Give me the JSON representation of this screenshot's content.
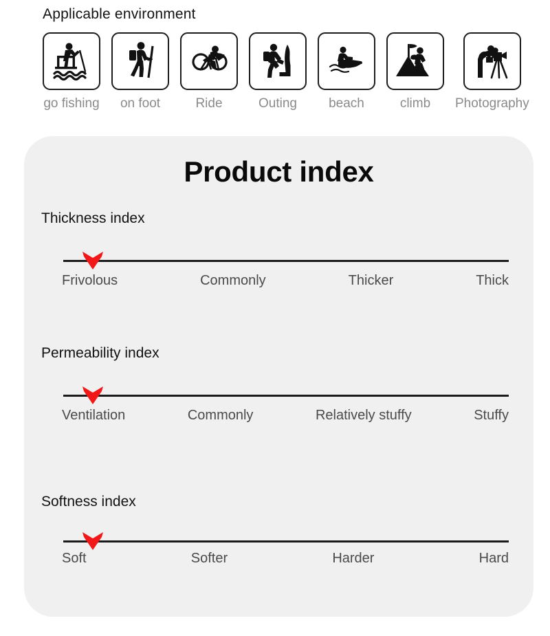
{
  "environment": {
    "title": "Applicable environment",
    "items": [
      {
        "icon": "fishing-icon",
        "label": "go fishing"
      },
      {
        "icon": "hiking-icon",
        "label": "on foot"
      },
      {
        "icon": "cycling-icon",
        "label": "Ride"
      },
      {
        "icon": "climbing-icon",
        "label": "Outing"
      },
      {
        "icon": "jet-ski-icon",
        "label": "beach"
      },
      {
        "icon": "mountain-icon",
        "label": "climb"
      },
      {
        "icon": "photography-icon",
        "label": "Photography"
      }
    ]
  },
  "product_index": {
    "title": "Product index",
    "marker_icon": "red-down-chevron-marker",
    "marker_color": "#f01818",
    "line_color": "#1a1a1a",
    "card_background": "#f0f0f0",
    "sections": [
      {
        "heading": "Thickness index",
        "marker_position_percent": 5,
        "labels": [
          "Frivolous",
          "Commonly",
          "Thicker",
          "Thick"
        ]
      },
      {
        "heading": "Permeability index",
        "marker_position_percent": 5,
        "labels": [
          "Ventilation",
          "Commonly",
          "Relatively stuffy",
          "Stuffy"
        ]
      },
      {
        "heading": "Softness index",
        "marker_position_percent": 5,
        "labels": [
          "Soft",
          "Softer",
          "Harder",
          "Hard"
        ]
      }
    ]
  }
}
